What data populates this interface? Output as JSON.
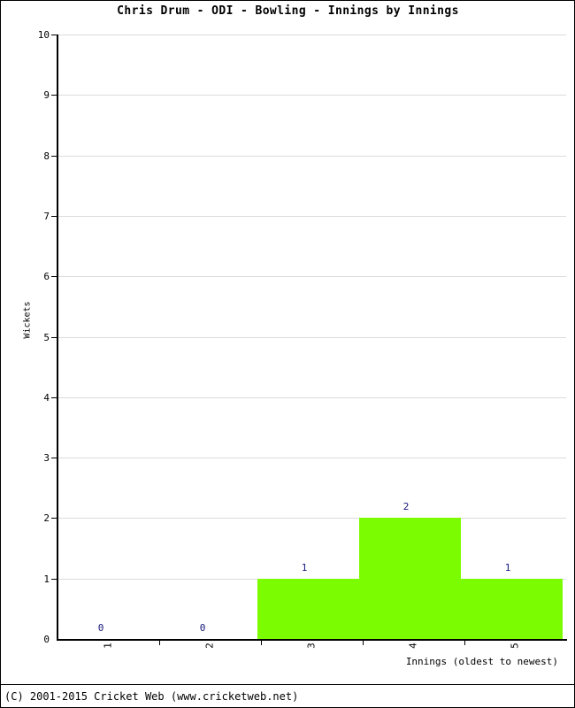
{
  "title": "Chris Drum - ODI - Bowling - Innings by Innings",
  "footer": "(C) 2001-2015 Cricket Web (www.cricketweb.net)",
  "axes": {
    "y_title": "Wickets",
    "x_title": "Innings (oldest to newest)",
    "y_ticks": [
      "0",
      "1",
      "2",
      "3",
      "4",
      "5",
      "6",
      "7",
      "8",
      "9",
      "10"
    ],
    "x_ticks": [
      "1",
      "2",
      "3",
      "4",
      "5"
    ]
  },
  "colors": {
    "bar": "#7cfc00",
    "value_label": "#15157a",
    "grid": "#dcdcdc",
    "axis": "#000000",
    "background": "#ffffff"
  },
  "chart_data": {
    "type": "bar",
    "title": "Chris Drum - ODI - Bowling - Innings by Innings",
    "xlabel": "Innings (oldest to newest)",
    "ylabel": "Wickets",
    "categories": [
      "1",
      "2",
      "3",
      "4",
      "5"
    ],
    "values": [
      0,
      0,
      1,
      2,
      1
    ],
    "data_labels": [
      "0",
      "0",
      "1",
      "2",
      "1"
    ],
    "ylim": [
      0,
      10
    ],
    "ytick_step": 1,
    "grid": true,
    "legend": false,
    "bar_gap": 0,
    "series": [
      {
        "name": "Wickets",
        "values": [
          0,
          0,
          1,
          2,
          1
        ]
      }
    ]
  }
}
